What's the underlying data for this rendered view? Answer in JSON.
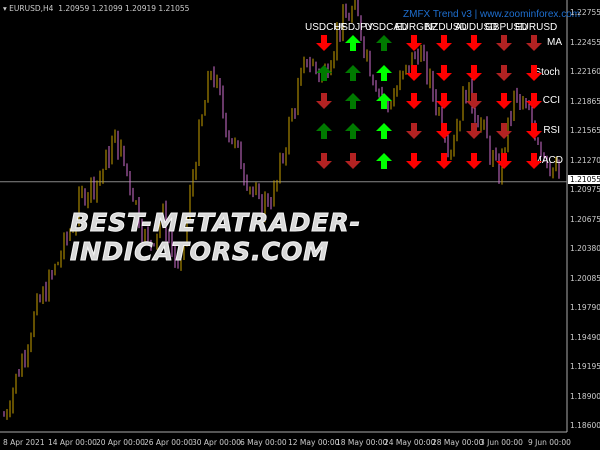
{
  "header": {
    "symbol": "EURUSD,H4",
    "ohlc": "1.20959 1.21099 1.20919 1.21055"
  },
  "indicator": {
    "title": "ZMFX Trend v3 | www.zoominforex.com",
    "symbols": [
      "USDCHF",
      "USDJPY",
      "USDCAD",
      "EURGBP",
      "NZDUSD",
      "AUDUSD",
      "GBPUSD",
      "EURUSD"
    ],
    "rows": [
      "MA",
      "Stoch",
      "CCI",
      "RSI",
      "MACD"
    ],
    "signals": [
      [
        "down-red",
        "up-darkgreen",
        "down-darkred",
        "up-darkgreen",
        "down-darkred"
      ],
      [
        "up-green",
        "up-darkgreen",
        "up-darkgreen",
        "up-darkgreen",
        "down-darkred"
      ],
      [
        "up-darkgreen",
        "up-green",
        "up-green",
        "up-green",
        "up-green"
      ],
      [
        "down-red",
        "down-red",
        "down-red",
        "down-darkred",
        "down-red"
      ],
      [
        "down-red",
        "down-red",
        "down-red",
        "down-red",
        "down-red"
      ],
      [
        "down-red",
        "down-red",
        "down-darkred",
        "down-darkred",
        "down-red"
      ],
      [
        "down-darkred",
        "down-darkred",
        "down-red",
        "down-darkred",
        "down-red"
      ],
      [
        "down-darkred",
        "down-red",
        "down-red",
        "down-red",
        "down-red"
      ]
    ],
    "colors": {
      "red": "#ff0000",
      "darkred": "#b22222",
      "green": "#00ff00",
      "darkgreen": "#007a00"
    }
  },
  "price_axis": [
    "1.22755",
    "1.22455",
    "1.22160",
    "1.21865",
    "1.21565",
    "1.21270",
    "1.20975",
    "1.20675",
    "1.20380",
    "1.20085",
    "1.19790",
    "1.19490",
    "1.19195",
    "1.18900",
    "1.18600"
  ],
  "current_price": "1.21055",
  "time_axis": [
    "8 Apr 2021",
    "14 Apr 00:00",
    "20 Apr 00:00",
    "26 Apr 00:00",
    "30 Apr 00:00",
    "6 May 00:00",
    "12 May 00:00",
    "18 May 00:00",
    "24 May 00:00",
    "28 May 00:00",
    "3 Jun 00:00",
    "9 Jun 00:00"
  ],
  "watermark": "BEST-METATRADER-INDICATORS.COM",
  "price_path": [
    1.187,
    1.192,
    1.1975,
    1.201,
    1.205,
    1.2095,
    1.211,
    1.215,
    1.21,
    1.204,
    1.207,
    1.201,
    1.213,
    1.222,
    1.216,
    1.212,
    1.208,
    1.2095,
    1.217,
    1.223,
    1.221,
    1.226,
    1.228,
    1.222,
    1.218,
    1.221,
    1.224,
    1.219,
    1.214,
    1.22,
    1.216,
    1.211,
    1.219,
    1.217,
    1.213,
    1.2105
  ]
}
